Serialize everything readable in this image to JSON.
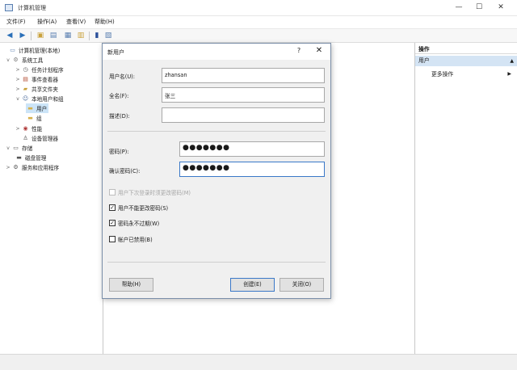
{
  "window": {
    "title": "计算机管理"
  },
  "menu": [
    "文件(F)",
    "操作(A)",
    "查看(V)",
    "帮助(H)"
  ],
  "tree": [
    {
      "label": "计算机管理(本地)",
      "icon": "computer-icon",
      "twisty": ""
    },
    {
      "label": "系统工具",
      "icon": "tools-icon",
      "twisty": "v"
    },
    {
      "label": "任务计划程序",
      "icon": "clock-icon",
      "twisty": ">"
    },
    {
      "label": "事件查看器",
      "icon": "event-viewer-icon",
      "twisty": ">"
    },
    {
      "label": "共享文件夹",
      "icon": "shared-folder-icon",
      "twisty": ">"
    },
    {
      "label": "本地用户和组",
      "icon": "users-groups-icon",
      "twisty": "v"
    },
    {
      "label": "用户",
      "icon": "folder-icon",
      "twisty": ""
    },
    {
      "label": "组",
      "icon": "folder-icon",
      "twisty": ""
    },
    {
      "label": "性能",
      "icon": "performance-icon",
      "twisty": ">"
    },
    {
      "label": "设备管理器",
      "icon": "device-manager-icon",
      "twisty": ""
    },
    {
      "label": "存储",
      "icon": "storage-icon",
      "twisty": "v"
    },
    {
      "label": "磁盘管理",
      "icon": "disk-icon",
      "twisty": ""
    },
    {
      "label": "服务和应用程序",
      "icon": "services-icon",
      "twisty": ">"
    }
  ],
  "actions": {
    "header": "操作",
    "section": "用户",
    "more": "更多操作"
  },
  "dialog": {
    "title": "新用户",
    "help_glyph": "?",
    "username_label": "用户名(U):",
    "username_value": "zhansan",
    "fullname_label": "全名(F):",
    "fullname_value": "张三",
    "description_label": "描述(D):",
    "description_value": "",
    "password_label": "密码(P):",
    "password_value": "●●●●●●●",
    "confirm_label": "确认密码(C):",
    "confirm_value": "●●●●●●●",
    "checkboxes": [
      {
        "label": "用户下次登录时须更改密码(M)",
        "checked": false,
        "disabled": true
      },
      {
        "label": "用户不能更改密码(S)",
        "checked": true,
        "disabled": false
      },
      {
        "label": "密码永不过期(W)",
        "checked": true,
        "disabled": false
      },
      {
        "label": "帐户已禁用(B)",
        "checked": false,
        "disabled": false
      }
    ],
    "help_button": "帮助(H)",
    "create_button": "创建(E)",
    "close_button": "关闭(O)"
  }
}
